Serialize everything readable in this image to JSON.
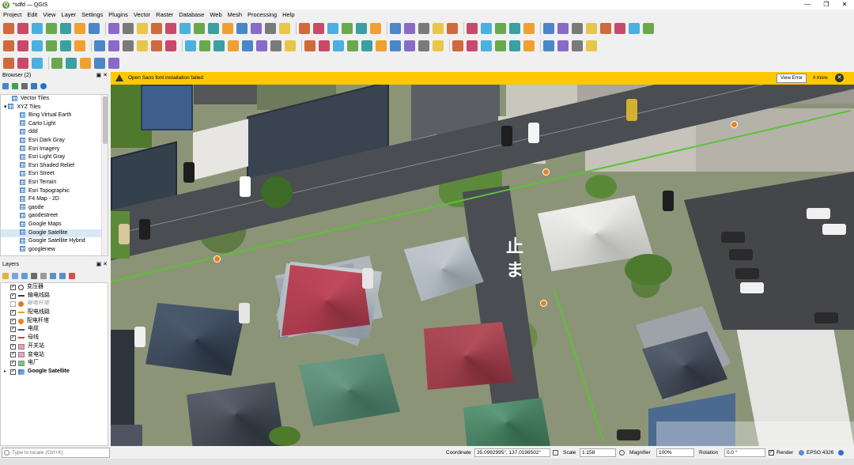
{
  "window": {
    "title": "*sdfd — QGIS",
    "minimize": "—",
    "maximize": "❐",
    "close": "✕"
  },
  "menu": [
    "Project",
    "Edit",
    "View",
    "Layer",
    "Settings",
    "Plugins",
    "Vector",
    "Raster",
    "Database",
    "Web",
    "Mesh",
    "Processing",
    "Help"
  ],
  "browser": {
    "title": "Browser (2)",
    "items": [
      {
        "label": "Vector Tiles",
        "indent": 1
      },
      {
        "label": "XYZ Tiles",
        "indent": 0,
        "expanded": true
      },
      {
        "label": "Bing Virtual Earth",
        "indent": 2
      },
      {
        "label": "Carto Light",
        "indent": 2
      },
      {
        "label": "ddd",
        "indent": 2
      },
      {
        "label": "Esri Dark Gray",
        "indent": 2
      },
      {
        "label": "Esri Imagery",
        "indent": 2
      },
      {
        "label": "Esri Light Gray",
        "indent": 2
      },
      {
        "label": "Esri Shaded Relief",
        "indent": 2
      },
      {
        "label": "Esri Street",
        "indent": 2
      },
      {
        "label": "Esri Terrain",
        "indent": 2
      },
      {
        "label": "Esri Topographic",
        "indent": 2
      },
      {
        "label": "F4 Map - 2D",
        "indent": 2
      },
      {
        "label": "gaode",
        "indent": 2
      },
      {
        "label": "gaodestreet",
        "indent": 2
      },
      {
        "label": "Google Maps",
        "indent": 2
      },
      {
        "label": "Google Satellite",
        "indent": 2,
        "selected": true
      },
      {
        "label": "Google Satellite Hybrid",
        "indent": 2
      },
      {
        "label": "googlenew",
        "indent": 2
      }
    ]
  },
  "layers": {
    "title": "Layers",
    "items": [
      {
        "label": "变压器",
        "checked": true,
        "symbol": "circle",
        "color": "#ffffff"
      },
      {
        "label": "输电线路",
        "checked": true,
        "symbol": "line",
        "color": "#3a3a3a"
      },
      {
        "label": "输电杆塔",
        "checked": false,
        "symbol": "dot",
        "color": "#e07a2a",
        "italic": true
      },
      {
        "label": "配电线路",
        "checked": true,
        "symbol": "line",
        "color": "#e6a020"
      },
      {
        "label": "配电杆塔",
        "checked": true,
        "symbol": "dot",
        "color": "#ef7f1a"
      },
      {
        "label": "电缆",
        "checked": true,
        "symbol": "dash",
        "color": "#555555"
      },
      {
        "label": "母线",
        "checked": true,
        "symbol": "line",
        "color": "#d23c3c"
      },
      {
        "label": "开关站",
        "checked": true,
        "symbol": "fill",
        "color": "#f29ab8"
      },
      {
        "label": "变电站",
        "checked": true,
        "symbol": "fill",
        "color": "#e9a0c8"
      },
      {
        "label": "电厂",
        "checked": true,
        "symbol": "fill",
        "color": "#78c878"
      },
      {
        "label": "Google Satellite",
        "checked": true,
        "symbol": "raster",
        "color": "#4a78b0",
        "bold": true,
        "expandable": true
      }
    ]
  },
  "warning": {
    "text": "Open Sans font installation failed",
    "view_button": "View Error",
    "more": "# more",
    "close": "✕"
  },
  "status": {
    "locator_placeholder": "Type to locate (Ctrl+K)",
    "coordinate_label": "Coordinate",
    "coordinate_value": "35.0992995°, 137.0198502°",
    "scale_label": "Scale",
    "scale_value": "1:158",
    "magnifier_label": "Magnifier",
    "magnifier_value": "100%",
    "rotation_label": "Rotation",
    "rotation_value": "0.0 °",
    "render_label": "Render",
    "crs": "EPSG:4326"
  },
  "colors": {
    "warning": "#ffc800",
    "selection": "#d9e8f7",
    "boundary": "#5bc236"
  }
}
